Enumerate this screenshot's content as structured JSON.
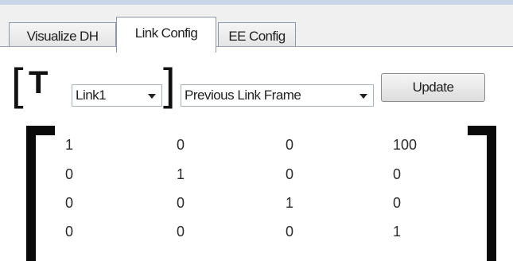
{
  "tabs": [
    {
      "label": "Visualize DH",
      "active": false
    },
    {
      "label": "Link Config",
      "active": true
    },
    {
      "label": "EE Config",
      "active": false
    }
  ],
  "transform": {
    "symbol": "T",
    "link_select": {
      "value": "Link1"
    },
    "frame_select": {
      "value": "Previous Link Frame"
    },
    "update_label": "Update"
  },
  "matrix": [
    [
      "1",
      "0",
      "0",
      "100"
    ],
    [
      "0",
      "1",
      "0",
      "0"
    ],
    [
      "0",
      "0",
      "1",
      "0"
    ],
    [
      "0",
      "0",
      "0",
      "1"
    ]
  ]
}
